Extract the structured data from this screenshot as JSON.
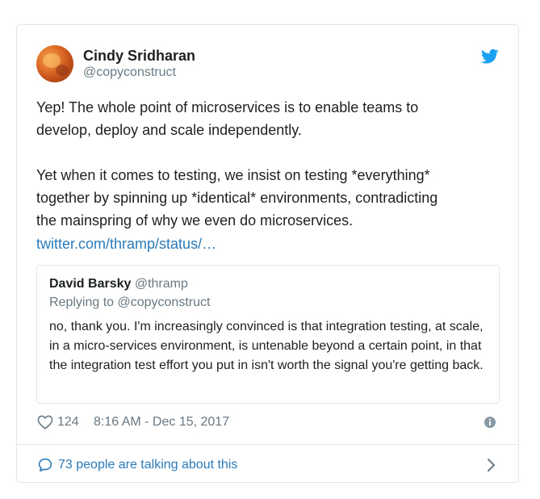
{
  "author": {
    "name": "Cindy Sridharan",
    "handle": "@copyconstruct"
  },
  "tweet": {
    "text": "Yep! The whole point of microservices is to enable teams to\ndevelop, deploy and scale independently.\n\nYet when it comes to testing, we insist on testing *everything*\ntogether by spinning up *identical* environments, contradicting\nthe mainspring of why we even do microservices.",
    "link": "twitter.com/thramp/status/…"
  },
  "quote": {
    "name": "David Barsky",
    "handle": "@thramp",
    "reply_to": "Replying to @copyconstruct",
    "text": "no, thank you. I'm increasingly convinced is that integration testing, at scale, in a micro-services environment, is untenable beyond a certain point, in that the integration test effort you put in isn't worth the signal you're getting back."
  },
  "footer": {
    "likes": "124",
    "timestamp": "8:16 AM - Dec 15, 2017"
  },
  "conversation": {
    "label": "73 people are talking about this"
  },
  "icons": {
    "brand": "twitter-bird-icon",
    "like": "heart-icon",
    "info": "info-icon",
    "reply": "speech-bubble-icon",
    "more": "chevron-right-icon"
  },
  "colors": {
    "link": "#2b7bb9",
    "twitter_blue": "#1da1f2",
    "muted": "#697882",
    "border": "#e1e8ed"
  }
}
